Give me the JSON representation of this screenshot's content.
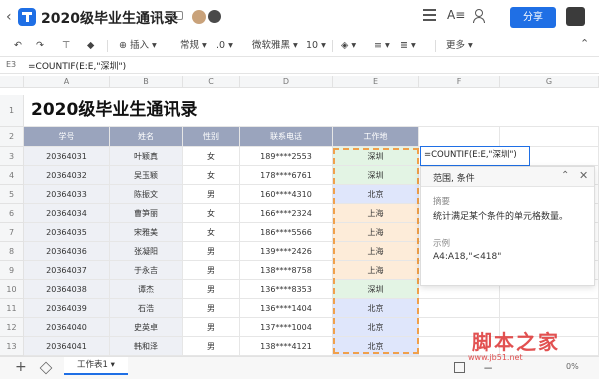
{
  "titlebar": {
    "title": "2020级毕业生通讯录",
    "share_label": "分享"
  },
  "toolbar": {
    "insert_label": "插入",
    "format_label": "常规",
    "decimal_label": ".0",
    "font_label": "微软雅黑",
    "size_label": "10",
    "more_label": "更多"
  },
  "formula_bar": {
    "cell_ref": "E3",
    "formula": "=COUNTIF(E:E,\"深圳\")"
  },
  "columns": [
    "A",
    "B",
    "C",
    "D",
    "E",
    "F",
    "G"
  ],
  "sheet": {
    "title": "2020级毕业生通讯录",
    "headers": [
      "学号",
      "姓名",
      "性别",
      "联系电话",
      "工作地"
    ],
    "rows": [
      [
        "20364031",
        "叶颖真",
        "女",
        "189****2553",
        "深圳"
      ],
      [
        "20364032",
        "吴玉颖",
        "女",
        "178****6761",
        "深圳"
      ],
      [
        "20364033",
        "陈振文",
        "男",
        "160****4310",
        "北京"
      ],
      [
        "20364034",
        "曹笋丽",
        "女",
        "166****2324",
        "上海"
      ],
      [
        "20364035",
        "宋雅美",
        "女",
        "186****5566",
        "上海"
      ],
      [
        "20364036",
        "张凝阳",
        "男",
        "139****2426",
        "上海"
      ],
      [
        "20364037",
        "于永吉",
        "男",
        "138****8758",
        "上海"
      ],
      [
        "20364038",
        "谭杰",
        "男",
        "136****8353",
        "深圳"
      ],
      [
        "20364039",
        "石浩",
        "男",
        "136****1404",
        "北京"
      ],
      [
        "20364040",
        "史英卓",
        "男",
        "137****1004",
        "北京"
      ],
      [
        "20364041",
        "韩和泽",
        "男",
        "138****4121",
        "北京"
      ]
    ],
    "row_numbers": [
      "1",
      "2",
      "3",
      "4",
      "5",
      "6",
      "7",
      "8",
      "9",
      "10",
      "11",
      "12",
      "13"
    ]
  },
  "editor": {
    "text": "=COUNTIF(E:E,\"深圳\")"
  },
  "function_tip": {
    "args": "范围, 条件",
    "summary_label": "摘要",
    "summary": "统计满足某个条件的单元格数量。",
    "example_label": "示例",
    "example": "A4:A18,\"<418\""
  },
  "bottombar": {
    "sheet_tab": "工作表1",
    "zoom": "0%"
  },
  "watermark": {
    "text": "脚本之家",
    "url": "www.jb51.net"
  },
  "colors": {
    "accent": "#1f6fe5",
    "header_fill": "#9aa4bd",
    "shenzhen_fill": "#e3f4e4",
    "beijing_fill": "#dfe6fb",
    "shanghai_fill": "#fdecd9",
    "selection_border": "#f0a04b"
  },
  "icons": [
    "back-icon",
    "app-logo-icon",
    "star-icon",
    "folder-icon",
    "menu-icon",
    "font-size-icon",
    "add-user-icon",
    "undo-icon",
    "redo-icon",
    "format-painter-icon",
    "eraser-icon",
    "fill-color-icon",
    "text-wrap-icon",
    "collapse-icon",
    "add-sheet-icon",
    "layers-icon"
  ]
}
